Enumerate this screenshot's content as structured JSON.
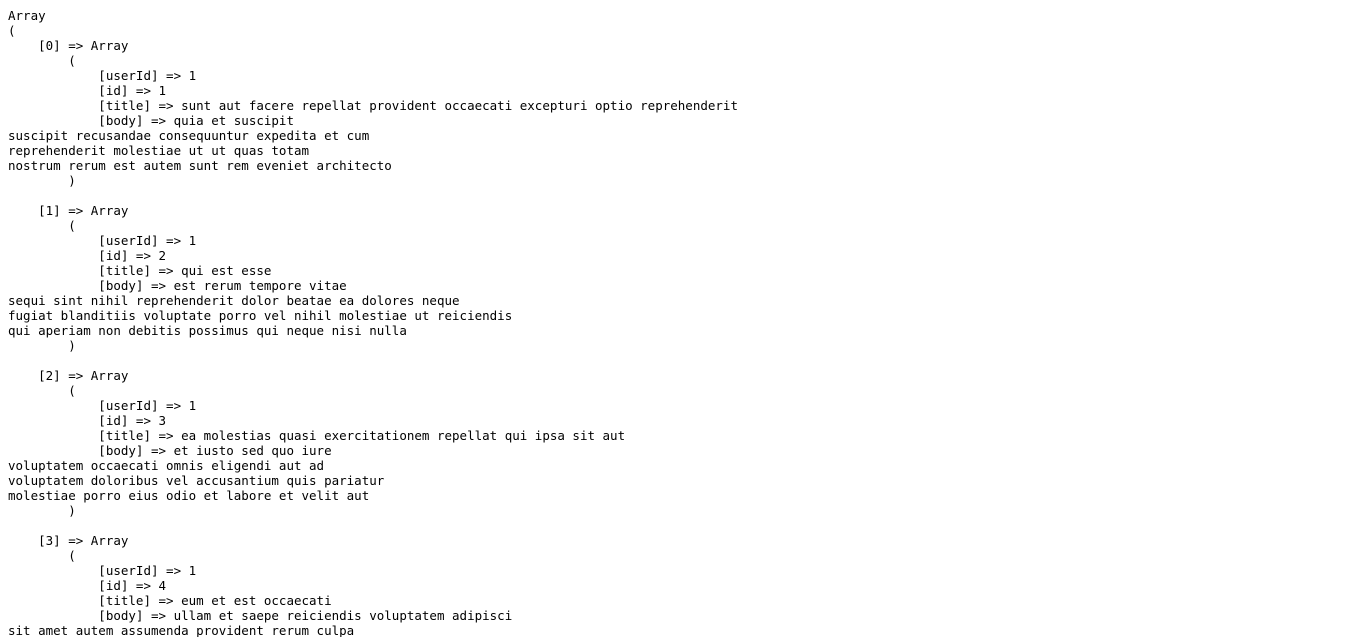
{
  "lines": [
    "Array",
    "(",
    "    [0] => Array",
    "        (",
    "            [userId] => 1",
    "            [id] => 1",
    "            [title] => sunt aut facere repellat provident occaecati excepturi optio reprehenderit",
    "            [body] => quia et suscipit",
    "suscipit recusandae consequuntur expedita et cum",
    "reprehenderit molestiae ut ut quas totam",
    "nostrum rerum est autem sunt rem eveniet architecto",
    "        )",
    "",
    "    [1] => Array",
    "        (",
    "            [userId] => 1",
    "            [id] => 2",
    "            [title] => qui est esse",
    "            [body] => est rerum tempore vitae",
    "sequi sint nihil reprehenderit dolor beatae ea dolores neque",
    "fugiat blanditiis voluptate porro vel nihil molestiae ut reiciendis",
    "qui aperiam non debitis possimus qui neque nisi nulla",
    "        )",
    "",
    "    [2] => Array",
    "        (",
    "            [userId] => 1",
    "            [id] => 3",
    "            [title] => ea molestias quasi exercitationem repellat qui ipsa sit aut",
    "            [body] => et iusto sed quo iure",
    "voluptatem occaecati omnis eligendi aut ad",
    "voluptatem doloribus vel accusantium quis pariatur",
    "molestiae porro eius odio et labore et velit aut",
    "        )",
    "",
    "    [3] => Array",
    "        (",
    "            [userId] => 1",
    "            [id] => 4",
    "            [title] => eum et est occaecati",
    "            [body] => ullam et saepe reiciendis voluptatem adipisci",
    "sit amet autem assumenda provident rerum culpa"
  ]
}
